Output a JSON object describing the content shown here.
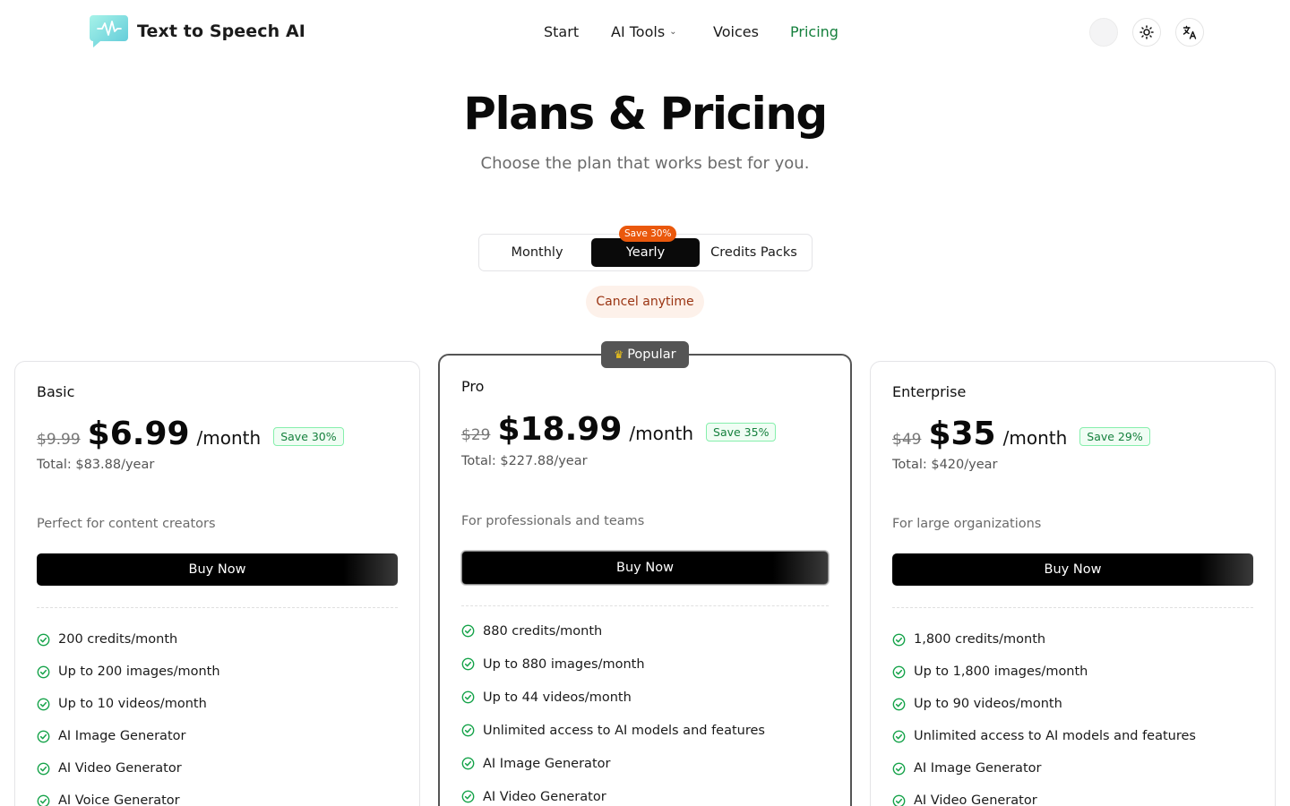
{
  "header": {
    "logo_text": "Text to Speech AI",
    "nav": [
      {
        "label": "Start"
      },
      {
        "label": "AI Tools"
      },
      {
        "label": "Voices"
      },
      {
        "label": "Pricing"
      }
    ],
    "accent_color": "#15803d"
  },
  "hero": {
    "title": "Plans & Pricing",
    "subtitle": "Choose the plan that works best for you."
  },
  "billing_toggle": {
    "options": [
      "Monthly",
      "Yearly",
      "Credits Packs"
    ],
    "selected": "Yearly",
    "save_badge": "Save 30%"
  },
  "cancel_note": "Cancel anytime",
  "popular_badge": "Popular",
  "plans": [
    {
      "name": "Basic",
      "old_price": "$9.99",
      "price": "$6.99",
      "period": "/month",
      "save": "Save 30%",
      "total": "Total: $83.88/year",
      "description": "Perfect for content creators",
      "cta": "Buy Now",
      "features": [
        "200 credits/month",
        "Up to 200 images/month",
        "Up to 10 videos/month",
        "AI Image Generator",
        "AI Video Generator",
        "AI Voice Generator"
      ]
    },
    {
      "name": "Pro",
      "old_price": "$29",
      "price": "$18.99",
      "period": "/month",
      "save": "Save 35%",
      "total": "Total: $227.88/year",
      "description": "For professionals and teams",
      "cta": "Buy Now",
      "features": [
        "880 credits/month",
        "Up to 880 images/month",
        "Up to 44 videos/month",
        "Unlimited access to AI models and features",
        "AI Image Generator",
        "AI Video Generator"
      ]
    },
    {
      "name": "Enterprise",
      "old_price": "$49",
      "price": "$35",
      "period": "/month",
      "save": "Save 29%",
      "total": "Total: $420/year",
      "description": "For large organizations",
      "cta": "Buy Now",
      "features": [
        "1,800 credits/month",
        "Up to 1,800 images/month",
        "Up to 90 videos/month",
        "Unlimited access to AI models and features",
        "AI Image Generator",
        "AI Video Generator"
      ]
    }
  ]
}
